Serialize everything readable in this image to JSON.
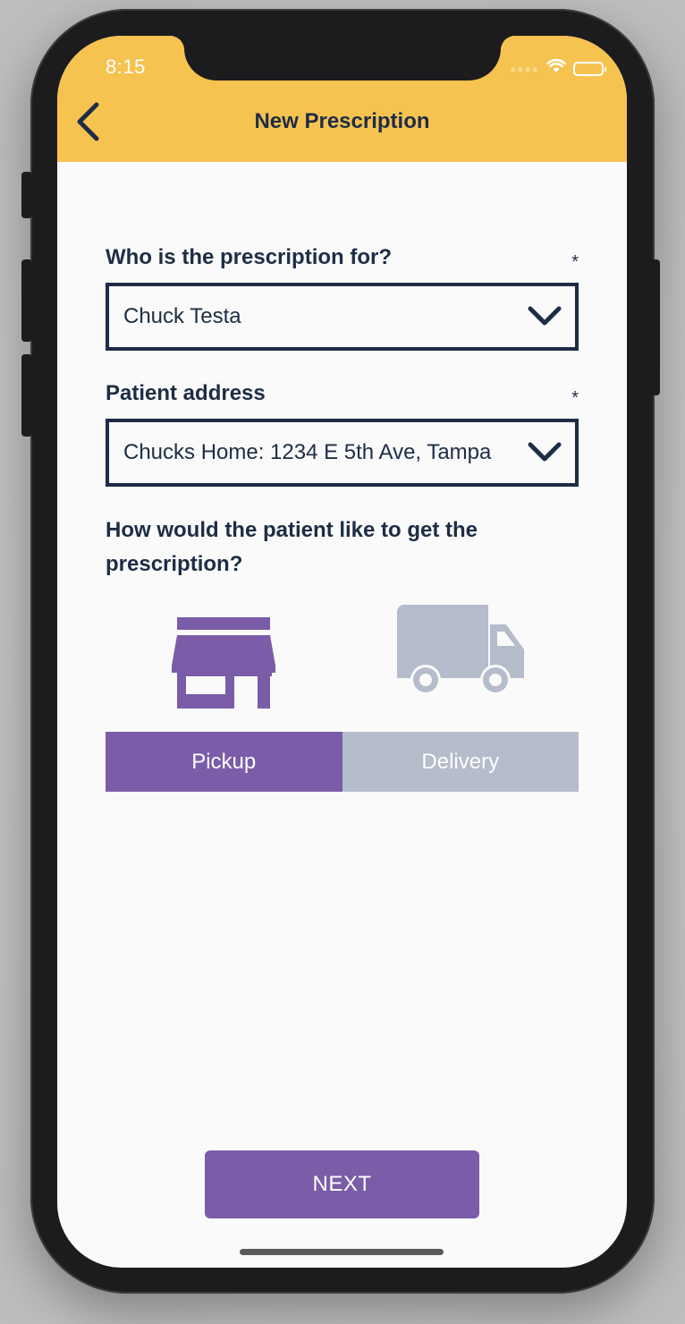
{
  "status_bar": {
    "time": "8:15"
  },
  "header": {
    "title": "New Prescription",
    "back_icon": "chevron-left-icon"
  },
  "form": {
    "patient": {
      "label": "Who is the prescription for?",
      "required_mark": "*",
      "value": "Chuck Testa"
    },
    "address": {
      "label": "Patient address",
      "required_mark": "*",
      "value": "Chucks Home: 1234 E 5th Ave, Tampa"
    },
    "fulfillment": {
      "question": "How would the patient like to get the prescription?",
      "options": [
        {
          "label": "Pickup",
          "icon": "store-icon",
          "selected": true
        },
        {
          "label": "Delivery",
          "icon": "truck-icon",
          "selected": false
        }
      ]
    }
  },
  "footer": {
    "next_label": "NEXT"
  },
  "colors": {
    "header_bg": "#f6c350",
    "text_dark": "#1e2d45",
    "accent_purple": "#7b5ca8",
    "inactive_gray": "#b5bccb"
  }
}
